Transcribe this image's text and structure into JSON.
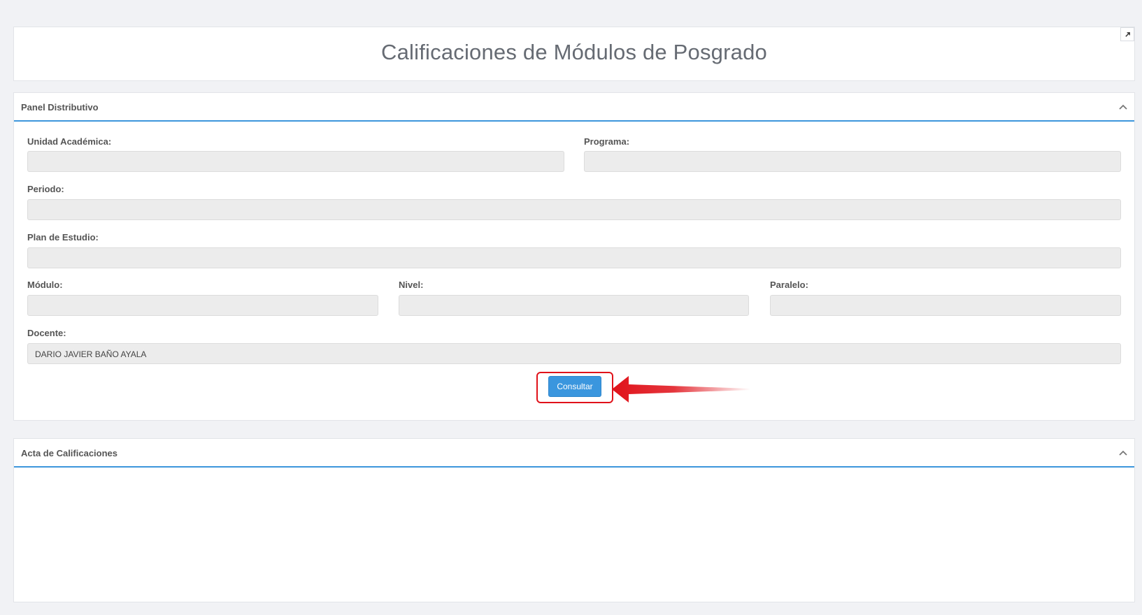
{
  "page": {
    "title": "Calificaciones de Módulos de Posgrado"
  },
  "panel_distributivo": {
    "title": "Panel Distributivo",
    "fields": {
      "unidad_label": "Unidad Académica:",
      "unidad_value": "",
      "programa_label": "Programa:",
      "programa_value": "",
      "periodo_label": "Periodo:",
      "periodo_value": "",
      "plan_label": "Plan de Estudio:",
      "plan_value": "",
      "modulo_label": "Módulo:",
      "modulo_value": "",
      "nivel_label": "Nivel:",
      "nivel_value": "",
      "paralelo_label": "Paralelo:",
      "paralelo_value": "",
      "docente_label": "Docente:",
      "docente_value": "DARIO JAVIER BAÑO AYALA"
    },
    "consultar_label": "Consultar"
  },
  "acta": {
    "title": "Acta de Calificaciones"
  },
  "icons": {
    "expand": "expand-icon",
    "collapse": "chevron-up-icon",
    "annotation": "red-arrow-icon"
  },
  "colors": {
    "accent": "#3d96dc",
    "button": "#3a96de",
    "annotation": "#e0121a",
    "input_bg": "#ececec"
  }
}
